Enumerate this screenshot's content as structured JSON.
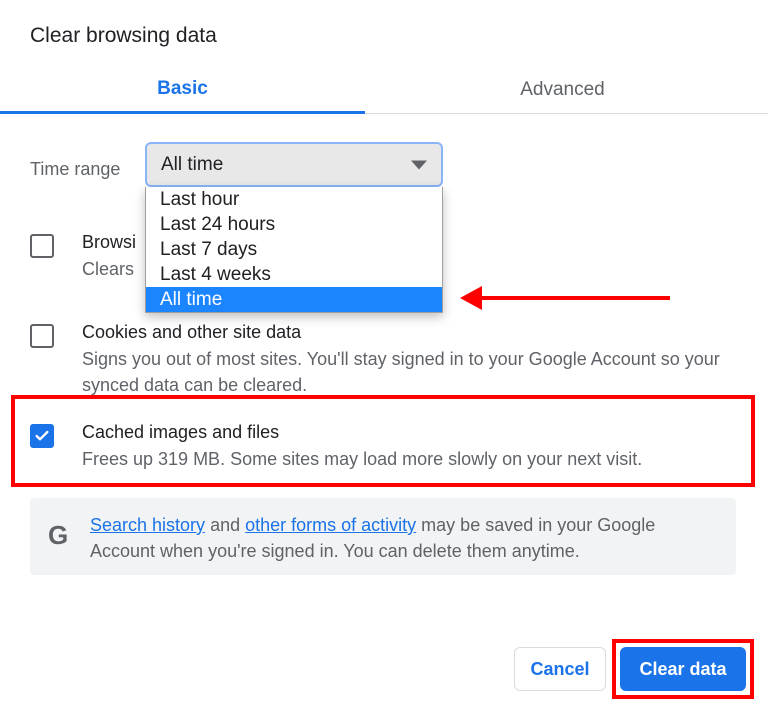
{
  "title": "Clear browsing data",
  "tabs": {
    "basic": "Basic",
    "advanced": "Advanced",
    "active": "basic"
  },
  "time_range": {
    "label": "Time range",
    "selected": "All time",
    "options": [
      "Last hour",
      "Last 24 hours",
      "Last 7 days",
      "Last 4 weeks",
      "All time"
    ],
    "highlighted": "All time"
  },
  "options": [
    {
      "id": "browsing-history",
      "checked": false,
      "title_visible": "Browsi",
      "desc_visible": "Clears "
    },
    {
      "id": "cookies",
      "checked": false,
      "title": "Cookies and other site data",
      "desc": "Signs you out of most sites. You'll stay signed in to your Google Account so your synced data can be cleared."
    },
    {
      "id": "cached",
      "checked": true,
      "title": "Cached images and files",
      "desc": "Frees up 319 MB. Some sites may load more slowly on your next visit."
    }
  ],
  "info": {
    "link1": "Search history",
    "mid1": " and ",
    "link2": "other forms of activity",
    "tail": " may be saved in your Google Account when you're signed in. You can delete them anytime."
  },
  "buttons": {
    "cancel": "Cancel",
    "clear": "Clear data"
  },
  "annotations": {
    "arrow_points_to": "All time",
    "box_around_option": "cached",
    "box_around_button": "clear"
  }
}
